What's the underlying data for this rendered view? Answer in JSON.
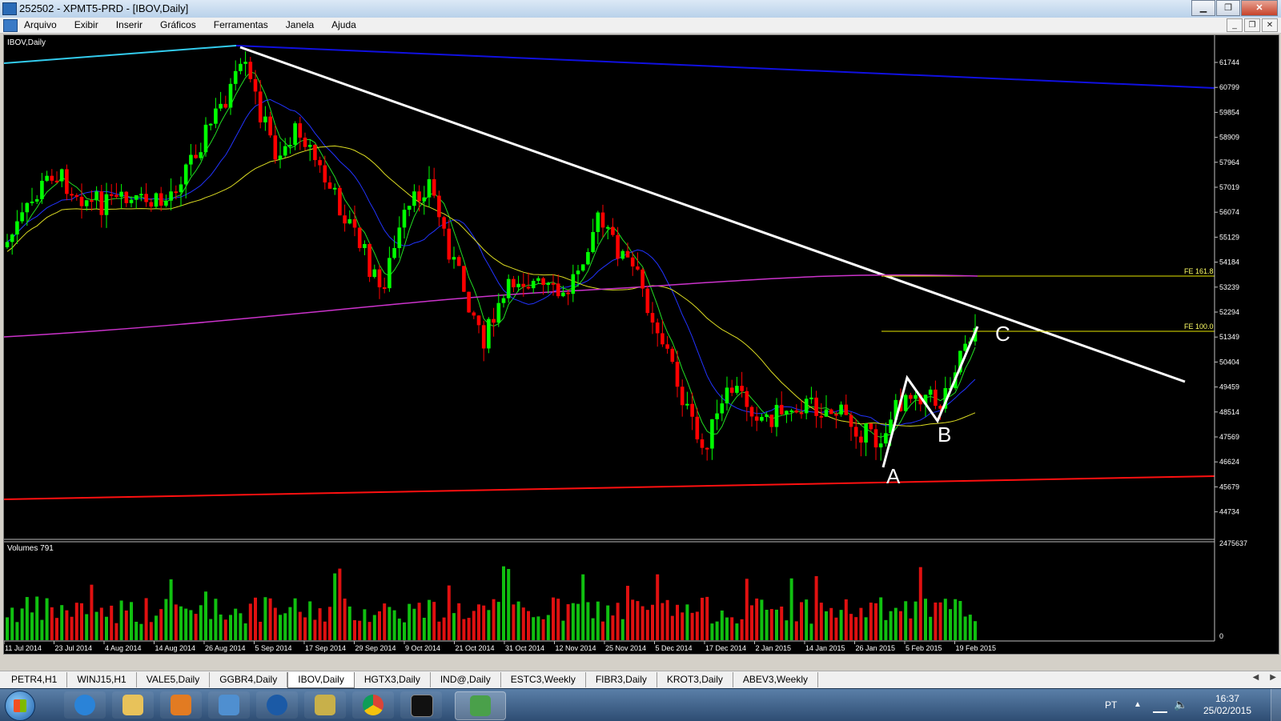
{
  "window": {
    "title": "252502 - XPMT5-PRD - [IBOV,Daily]"
  },
  "menu": [
    "Arquivo",
    "Exibir",
    "Inserir",
    "Gráficos",
    "Ferramentas",
    "Janela",
    "Ajuda"
  ],
  "chart": {
    "label": "IBOV,Daily",
    "volume_label": "Volumes 791",
    "price_ticks": [
      "61744",
      "60799",
      "59854",
      "58909",
      "57964",
      "57019",
      "56074",
      "55129",
      "54184",
      "53239",
      "52294",
      "51349",
      "50404",
      "49459",
      "48514",
      "47569",
      "46624",
      "45679",
      "44734"
    ],
    "volume_ticks": [
      "2475637",
      "0"
    ],
    "date_ticks": [
      "11 Jul 2014",
      "23 Jul 2014",
      "4 Aug 2014",
      "14 Aug 2014",
      "26 Aug 2014",
      "5 Sep 2014",
      "17 Sep 2014",
      "29 Sep 2014",
      "9 Oct 2014",
      "21 Oct 2014",
      "31 Oct 2014",
      "12 Nov 2014",
      "25 Nov 2014",
      "5 Dec 2014",
      "17 Dec 2014",
      "2 Jan 2015",
      "14 Jan 2015",
      "26 Jan 2015",
      "5 Feb 2015",
      "19 Feb 2015"
    ],
    "fib_labels": [
      "FE 161.8",
      "FE 100.0"
    ],
    "points": [
      "A",
      "B",
      "C"
    ],
    "colors": {
      "bull": "#00ff00",
      "bear": "#ff0000",
      "background": "#000000"
    }
  },
  "tabs": [
    "PETR4,H1",
    "WINJ15,H1",
    "VALE5,Daily",
    "GGBR4,Daily",
    "IBOV,Daily",
    "HGTX3,Daily",
    "IND@,Daily",
    "ESTC3,Weekly",
    "FIBR3,Daily",
    "KROT3,Daily",
    "ABEV3,Weekly"
  ],
  "active_tab": "IBOV,Daily",
  "tray": {
    "lang": "PT",
    "time": "16:37",
    "date": "25/02/2015"
  }
}
